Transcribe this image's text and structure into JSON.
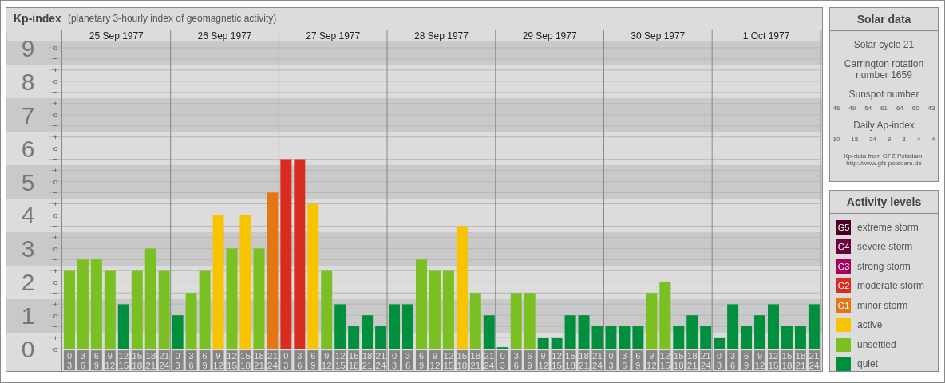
{
  "header": {
    "title": "Kp-index",
    "subtitle": "(planetary 3-hourly index of geomagnetic activity)"
  },
  "kp_chart": {
    "chart_data": {
      "type": "bar",
      "ylim": [
        0,
        9
      ],
      "grid": true,
      "yticks": [
        0,
        1,
        2,
        3,
        4,
        5,
        6,
        7,
        8,
        9
      ],
      "categories": [
        "0 3",
        "3 6",
        "6 9",
        "9 12",
        "12 15",
        "15 18",
        "18 21",
        "21 24",
        "0 3",
        "3 6",
        "6 9",
        "9 12",
        "12 15",
        "15 18",
        "18 21",
        "21 24",
        "0 3",
        "3 6",
        "6 9",
        "9 12",
        "12 15",
        "15 18",
        "18 21",
        "21 24",
        "0 3",
        "3 6",
        "6 9",
        "9 12",
        "12 15",
        "15 18",
        "18 21",
        "21 24",
        "0 3",
        "3 6",
        "6 9",
        "9 12",
        "12 15",
        "15 18",
        "18 21",
        "21 24",
        "0 3",
        "3 6",
        "6 9",
        "9 12",
        "12 15",
        "15 18",
        "18 21",
        "21 24",
        "0 3",
        "3 6",
        "6 9",
        "9 12",
        "12 15",
        "15 18",
        "18 21",
        "21 24"
      ],
      "series": [
        {
          "values": [
            2.33,
            2.67,
            2.67,
            2.33,
            1.33,
            2.33,
            3,
            2.33,
            1,
            1.67,
            2.33,
            4,
            3,
            4,
            3,
            4.67,
            5.67,
            5.67,
            4.33,
            2.33,
            1.33,
            0.67,
            1,
            0.67,
            1.33,
            1.33,
            2.67,
            2.33,
            2.33,
            3.67,
            1.67,
            1,
            0,
            1.67,
            1.67,
            0.33,
            0.33,
            1,
            1,
            0.67,
            0.67,
            0.67,
            0.67,
            1.67,
            2,
            0.67,
            1,
            0.67,
            0.33,
            1.33,
            0.67,
            1,
            1.33,
            0.67,
            0.67,
            1.33
          ]
        }
      ]
    },
    "day_labels": [
      "25 Sep 1977",
      "26 Sep 1977",
      "27 Sep 1977",
      "28 Sep 1977",
      "29 Sep 1977",
      "30 Sep 1977",
      "1 Oct 1977"
    ],
    "minor_ticks": [
      "o",
      "−",
      "+",
      "o",
      "−",
      "+",
      "o",
      "−",
      "+",
      "o",
      "−",
      "+",
      "o",
      "−",
      "+",
      "o",
      "−",
      "+",
      "o",
      "−",
      "+",
      "o",
      "−",
      "+",
      "o",
      "−",
      "+",
      "o"
    ]
  },
  "solar_data": {
    "title": "Solar data",
    "solar_cycle": "Solar cycle 21",
    "carrington": "Carrington rotation number 1659",
    "sunspot_label": "Sunspot number",
    "sunspot_numbers": [
      "46",
      "49",
      "54",
      "61",
      "64",
      "60",
      "43"
    ],
    "ap_label": "Daily Ap-index",
    "ap_values": [
      "10",
      "18",
      "24",
      "9",
      "3",
      "4",
      "4"
    ],
    "source": "Kp-data from GFZ Potsdam:",
    "source_url": "http://www.gfz-potsdam.de"
  },
  "legend": {
    "title": "Activity levels",
    "items": [
      {
        "badge": "G5",
        "label": "extreme storm",
        "color": "#4a0026"
      },
      {
        "badge": "G4",
        "label": "severe storm",
        "color": "#6b0040"
      },
      {
        "badge": "G3",
        "label": "strong storm",
        "color": "#a8005e"
      },
      {
        "badge": "G2",
        "label": "moderate storm",
        "color": "#d82c1e"
      },
      {
        "badge": "G1",
        "label": "minor storm",
        "color": "#e37716"
      },
      {
        "label": "active",
        "color": "#f8c400"
      },
      {
        "label": "unsettled",
        "color": "#7ac022"
      },
      {
        "label": "quiet",
        "color": "#008f3c"
      }
    ]
  }
}
